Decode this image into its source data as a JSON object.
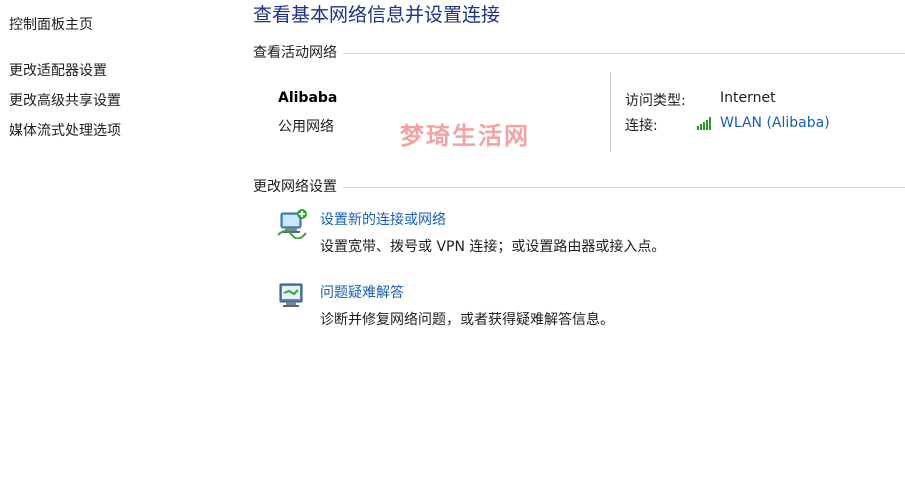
{
  "sidebar": {
    "items": [
      {
        "label": "控制面板主页"
      },
      {
        "label": "更改适配器设置"
      },
      {
        "label": "更改高级共享设置"
      },
      {
        "label": "媒体流式处理选项"
      }
    ]
  },
  "page": {
    "title": "查看基本网络信息并设置连接"
  },
  "active_networks": {
    "header": "查看活动网络",
    "network_name": "Alibaba",
    "network_type": "公用网络",
    "access_type_label": "访问类型:",
    "access_type_value": "Internet",
    "connections_label": "连接:",
    "connection_value": "WLAN (Alibaba)",
    "connection_icon": "wifi-signal-icon"
  },
  "change_settings": {
    "header": "更改网络设置",
    "tasks": [
      {
        "icon": "new-connection-icon",
        "title": "设置新的连接或网络",
        "description": "设置宽带、拨号或 VPN 连接；或设置路由器或接入点。"
      },
      {
        "icon": "troubleshoot-icon",
        "title": "问题疑难解答",
        "description": "诊断并修复网络问题，或者获得疑难解答信息。"
      }
    ]
  },
  "watermark": "梦琦生活网",
  "colors": {
    "link": "#1a5fb4",
    "title": "#1e3287",
    "divider": "#d5dbe4",
    "watermark": "#e85656"
  }
}
